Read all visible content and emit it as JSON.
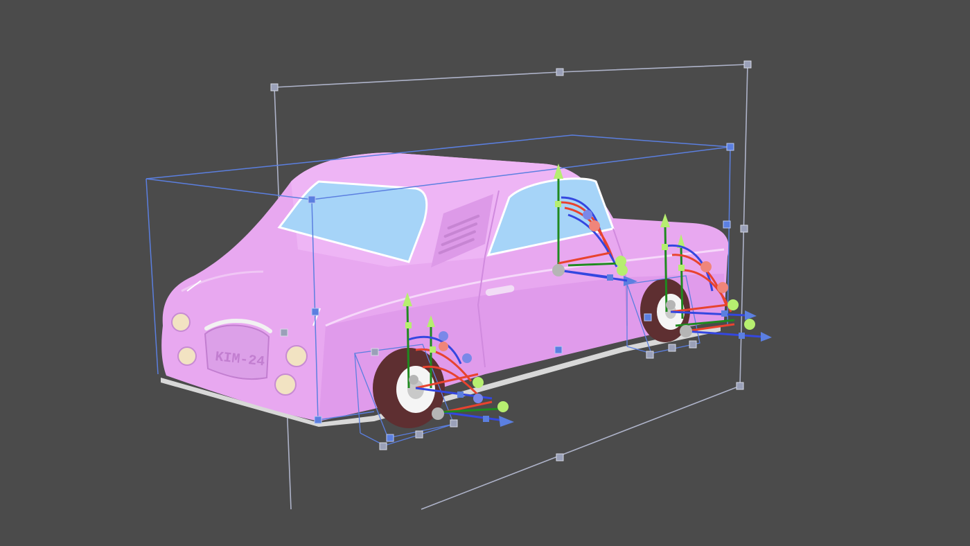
{
  "viewport": {
    "background_color": "#4b4b4b",
    "selection_color": "#aeb3c9",
    "inner_box_color": "#5b7fe0",
    "gizmo_colors": {
      "x_axis": "#e8432f",
      "y_axis": "#1f8a1f",
      "z_axis": "#3447e0",
      "y_tip": "#b6ee70"
    }
  },
  "car": {
    "body_color": "#e8a8f0",
    "window_color": "#a6d4f8",
    "tire_color": "#5e2f31",
    "license_plate": "KIM-24"
  },
  "gizmos": {
    "front_wheel": "transform-gizmo-front-wheel",
    "rear_wheel": "transform-gizmo-rear-wheel",
    "door": "transform-gizmo-door"
  }
}
